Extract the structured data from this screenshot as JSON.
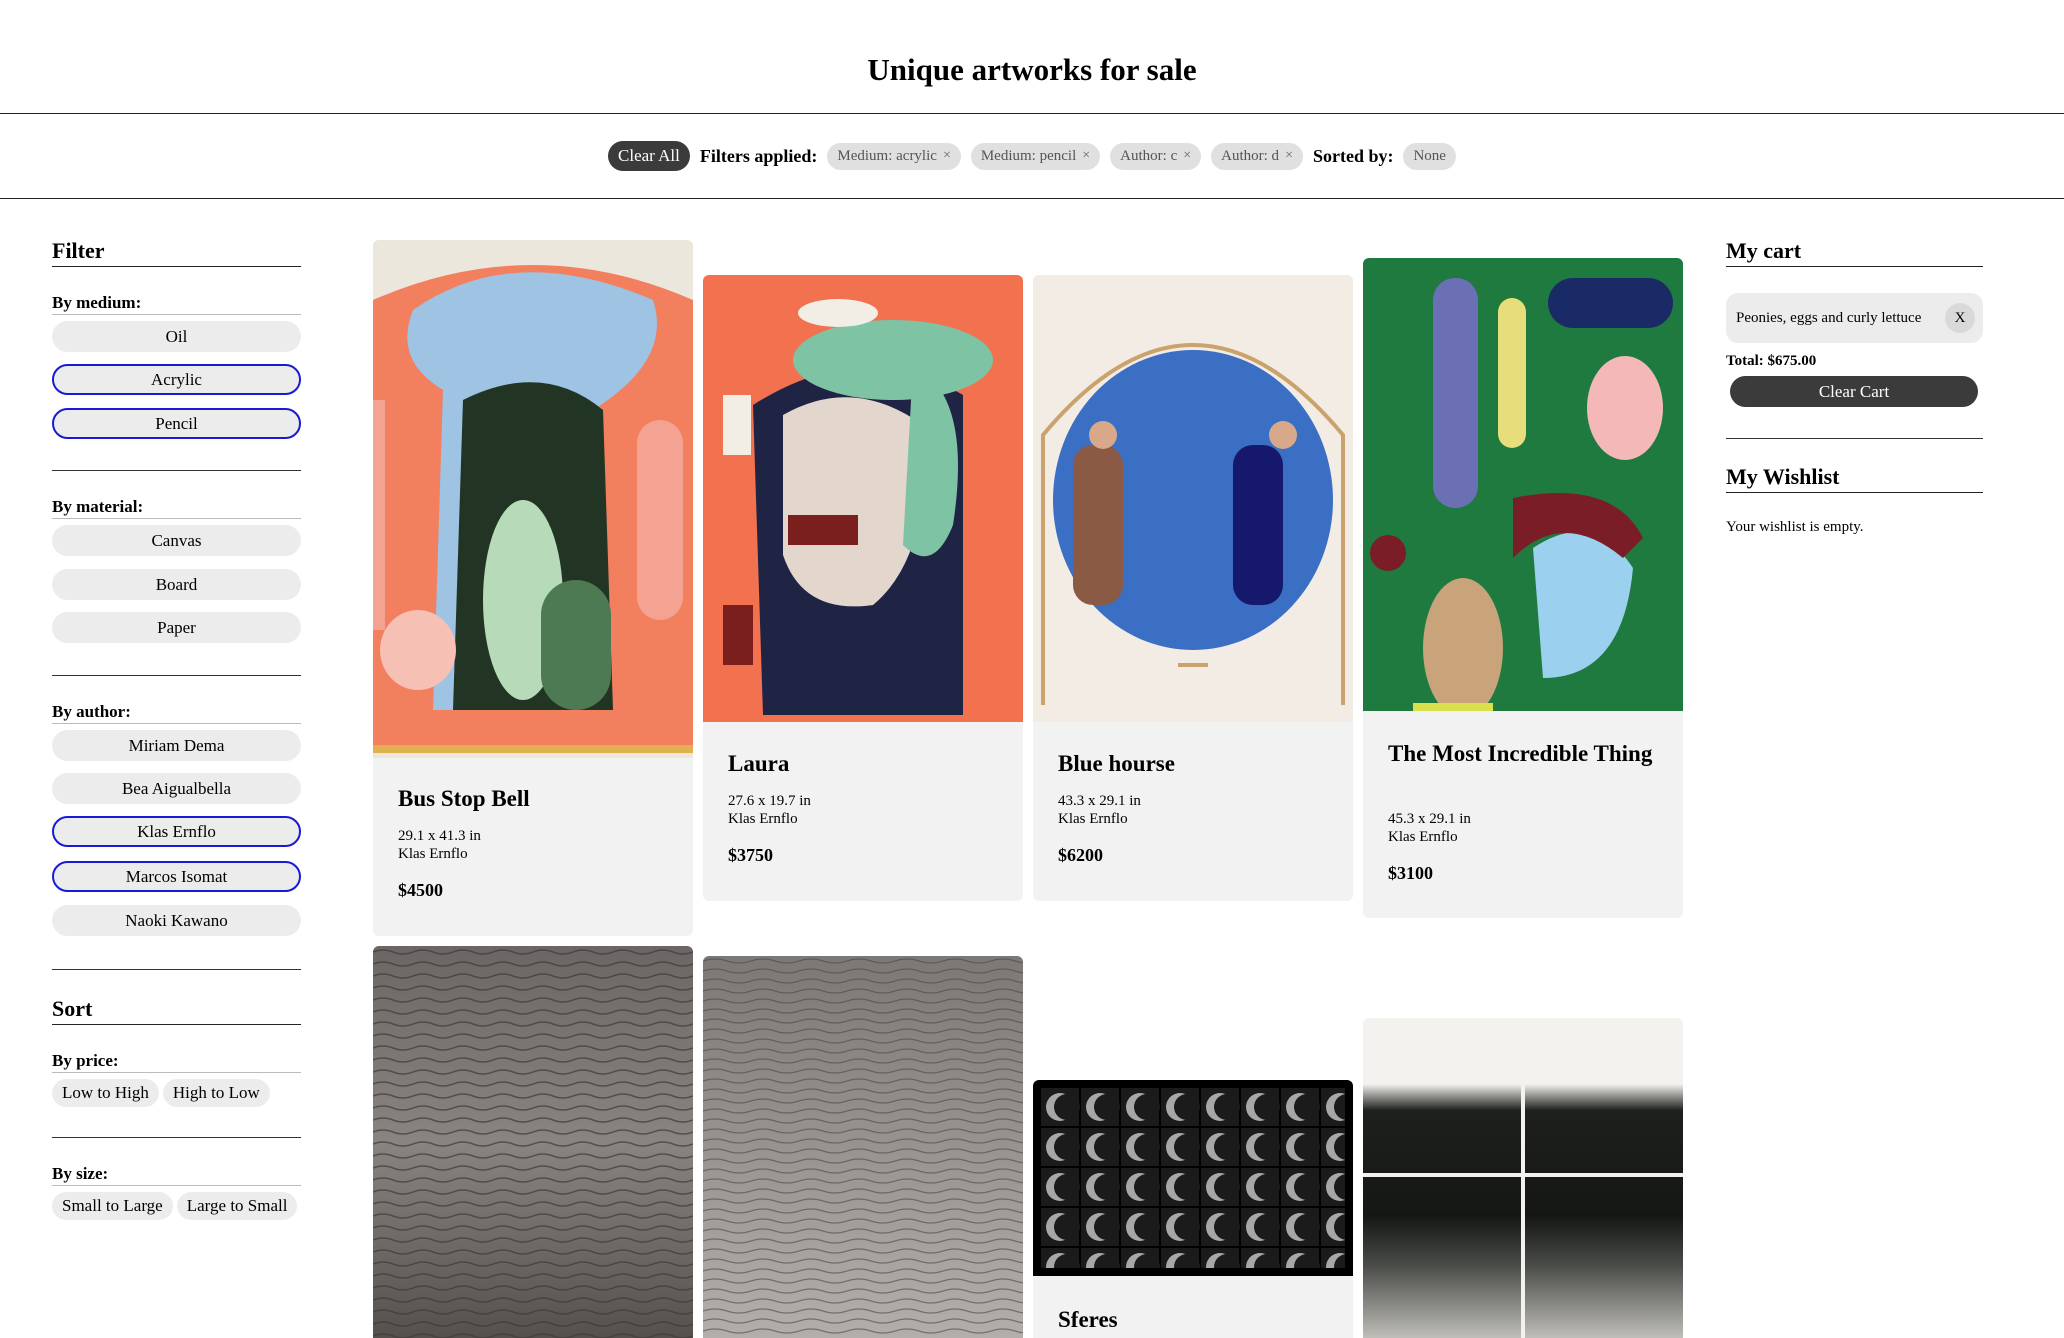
{
  "title": "Unique artworks for sale",
  "filter_bar": {
    "clear_all": "Clear All",
    "filters_label": "Filters applied:",
    "chips": [
      "Medium: acrylic",
      "Medium: pencil",
      "Author: c",
      "Author: d"
    ],
    "remove_glyph": "×",
    "sorted_label": "Sorted by:",
    "sorted_value": "None"
  },
  "filter": {
    "heading": "Filter",
    "medium": {
      "label": "By medium:",
      "options": [
        "Oil",
        "Acrylic",
        "Pencil"
      ],
      "selected": [
        "Acrylic",
        "Pencil"
      ]
    },
    "material": {
      "label": "By material:",
      "options": [
        "Canvas",
        "Board",
        "Paper"
      ]
    },
    "author": {
      "label": "By author:",
      "options": [
        "Miriam Dema",
        "Bea Aigualbella",
        "Klas Ernflo",
        "Marcos Isomat",
        "Naoki Kawano"
      ],
      "selected": [
        "Klas Ernflo",
        "Marcos Isomat"
      ]
    }
  },
  "sort": {
    "heading": "Sort",
    "price": {
      "label": "By price:",
      "options": [
        "Low to High",
        "High to Low"
      ]
    },
    "size": {
      "label": "By size:",
      "options": [
        "Small to Large",
        "Large to Small"
      ]
    }
  },
  "artworks": [
    {
      "title": "Bus Stop Bell",
      "size": "29.1 x 41.3 in",
      "author": "Klas Ernflo",
      "price": "$4500"
    },
    {
      "title": "Laura",
      "size": "27.6 x 19.7 in",
      "author": "Klas Ernflo",
      "price": "$3750"
    },
    {
      "title": "Blue hourse",
      "size": "43.3 x 29.1 in",
      "author": "Klas Ernflo",
      "price": "$6200"
    },
    {
      "title": "The Most Incredible Thing",
      "size": "45.3 x 29.1 in",
      "author": "Klas Ernflo",
      "price": "$3100"
    },
    {
      "title": "Sferes"
    }
  ],
  "cart": {
    "heading": "My cart",
    "items": [
      {
        "name": "Peonies, eggs and curly lettuce",
        "remove": "X"
      }
    ],
    "total": "Total: $675.00",
    "clear": "Clear Cart"
  },
  "wishlist": {
    "heading": "My Wishlist",
    "empty": "Your wishlist is empty."
  },
  "colors": {
    "selected_border": "#1a1ad6",
    "dark_button": "#3b3b3b",
    "card_bg": "#f2f2f2"
  }
}
